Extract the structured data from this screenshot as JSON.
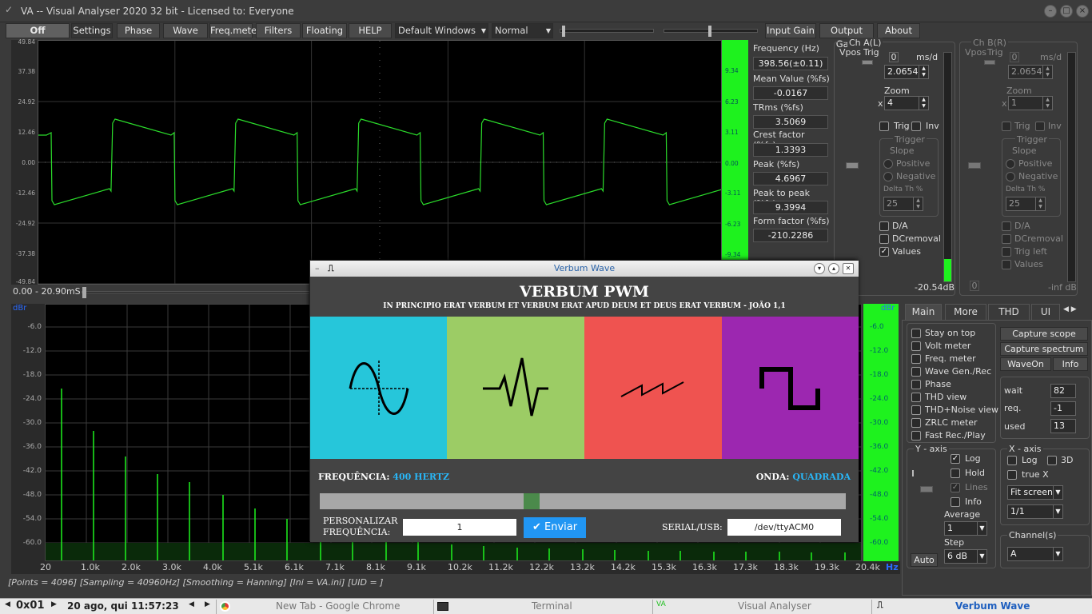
{
  "window": {
    "title": "VA -- Visual Analyser 2020 32 bit - Licensed to: Everyone"
  },
  "toolbar": {
    "off": "Off",
    "settings": "Settings",
    "phase": "Phase",
    "wave": "Wave",
    "freqmeter": "Freq.meter",
    "filters": "Filters",
    "floating": "Floating",
    "help": "HELP",
    "device": "Default Windows inp",
    "mode": "Normal",
    "input_gain": "Input Gain",
    "output_gain": "Output Gain",
    "about": "About"
  },
  "scope": {
    "yticks": [
      "49.84",
      "37.38",
      "24.92",
      "12.46",
      "0.00",
      "-12.46",
      "-24.92",
      "-37.38",
      "-49.84"
    ],
    "right_ticks": [
      "9.34",
      "6.23",
      "3.11",
      "0.00",
      "-3.11",
      "-6.23",
      "-9.34"
    ],
    "time_label": "0.00 - 20.90mS"
  },
  "measurements": [
    {
      "label": "Frequency (Hz)",
      "value": "398.56(±0.11)"
    },
    {
      "label": "Mean Value (%fs)",
      "value": "-0.0167"
    },
    {
      "label": "TRms (%fs)",
      "value": "3.5069"
    },
    {
      "label": "Crest factor (%fs)",
      "value": "1.3393"
    },
    {
      "label": "Peak (%fs)",
      "value": "4.6967"
    },
    {
      "label": "Peak to peak (%fs)",
      "value": "9.3994"
    },
    {
      "label": "Form factor (%fs)",
      "value": "-210.2286"
    }
  ],
  "chA": {
    "title": "Ch A(L)",
    "vpos": "Vpos",
    "trig": "Trig",
    "ms_label": "ms/d",
    "ms_value": "2.0654",
    "zero": "0",
    "zoom_label": "Zoom",
    "x": "x",
    "zoom_value": "4",
    "trig_chk": "Trig",
    "inv_chk": "Inv",
    "trigger": "Trigger",
    "slope": "Slope",
    "positive": "Positive",
    "negative": "Negative",
    "delta": "Delta Th %",
    "delta_value": "25",
    "da": "D/A",
    "dcremoval": "DCremoval",
    "values": "Values",
    "level": "-20.54dB"
  },
  "chB": {
    "title": "Ch B(R)",
    "vpos": "Vpos",
    "trig": "Trig",
    "ms_label": "ms/d",
    "ms_value": "2.0654",
    "zero": "0",
    "zoom_label": "Zoom",
    "x": "x",
    "zoom_value": "1",
    "trig_chk": "Trig",
    "inv_chk": "Inv",
    "trigger": "Trigger",
    "slope": "Slope",
    "positive": "Positive",
    "negative": "Negative",
    "delta": "Delta Th %",
    "delta_value": "25",
    "da": "D/A",
    "dcremoval": "DCremoval",
    "trigleft": "Trig left",
    "values": "Values",
    "zero2": "0",
    "level": "-inf dB"
  },
  "spectrum": {
    "unit": "dBr",
    "yticks": [
      "-6.0",
      "-12.0",
      "-18.0",
      "-24.0",
      "-30.0",
      "-36.0",
      "-42.0",
      "-48.0",
      "-54.0",
      "-60.0"
    ],
    "right_ticks": [
      "-6.0",
      "-12.0",
      "-18.0",
      "-24.0",
      "-30.0",
      "-36.0",
      "-42.0",
      "-48.0",
      "-54.0",
      "-60.0"
    ],
    "xticks": [
      "20",
      "1.0k",
      "2.0k",
      "3.0k",
      "4.0k",
      "5.1k",
      "6.1k",
      "7.1k",
      "8.1k",
      "9.1k",
      "10.2k",
      "11.2k",
      "12.2k",
      "13.2k",
      "14.2k",
      "15.3k",
      "16.3k",
      "17.3k",
      "18.3k",
      "19.3k",
      "20.4k"
    ],
    "hz": "Hz",
    "status": "[Points = 4096]  [Sampling = 40960Hz]  [Smoothing = Hanning]  [Ini = VA.ini]  [UID = ]"
  },
  "tabs": [
    "Main",
    "More",
    "THD",
    "UI"
  ],
  "main_panel": {
    "options": [
      "Stay on top",
      "Volt meter",
      "Freq. meter",
      "Wave Gen./Rec",
      "Phase",
      "THD view",
      "THD+Noise view",
      "ZRLC meter",
      "Fast Rec./Play"
    ],
    "capture_scope": "Capture scope",
    "capture_spectrum": "Capture spectrum",
    "waveon": "WaveOn",
    "info": "Info",
    "wait_label": "wait",
    "wait": "82",
    "req_label": "req.",
    "req": "-1",
    "used_label": "used",
    "used": "13",
    "yaxis": "Y - axis",
    "log": "Log",
    "hold": "Hold",
    "lines": "Lines",
    "info_chk": "Info",
    "average": "Average",
    "average_value": "1",
    "step": "Step",
    "step_value": "6 dB",
    "auto": "Auto",
    "xaxis": "X - axis",
    "xlog": "Log",
    "x3d": "3D",
    "truex": "true X",
    "fit": "Fit screen",
    "ratio": "1/1",
    "channels": "Channel(s)",
    "channel_value": "A"
  },
  "verbum": {
    "window_title": "Verbum Wave",
    "title": "VERBUM PWM",
    "subtitle": "IN PRINCIPIO ERAT VERBUM ET VERBUM ERAT APUD DEUM ET DEUS ERAT VERBUM - JOÃO 1,1",
    "freq_label": "FREQUÊNCIA:",
    "freq_value": "400 HERTZ",
    "wave_label": "ONDA:",
    "wave_value": "QUADRADA",
    "custom_label1": "PERSONALIZAR",
    "custom_label2": "FREQUÊNCIA:",
    "custom_value": "1",
    "send": "Enviar",
    "serial_label": "SERIAL/USB:",
    "serial_value": "/dev/ttyACM0",
    "colors": {
      "sine": "#26c6da",
      "noise": "#9ccc65",
      "saw": "#ef5350",
      "square": "#9c27b0",
      "accent": "#29b6f6"
    },
    "slider_fraction": 0.4
  },
  "taskbar": {
    "ws": "0x01",
    "datetime": "20 ago, qui 11:57:23",
    "chrome": "New Tab - Google Chrome",
    "terminal": "Terminal",
    "va": "Visual Analyser",
    "verbum": "Verbum Wave"
  }
}
